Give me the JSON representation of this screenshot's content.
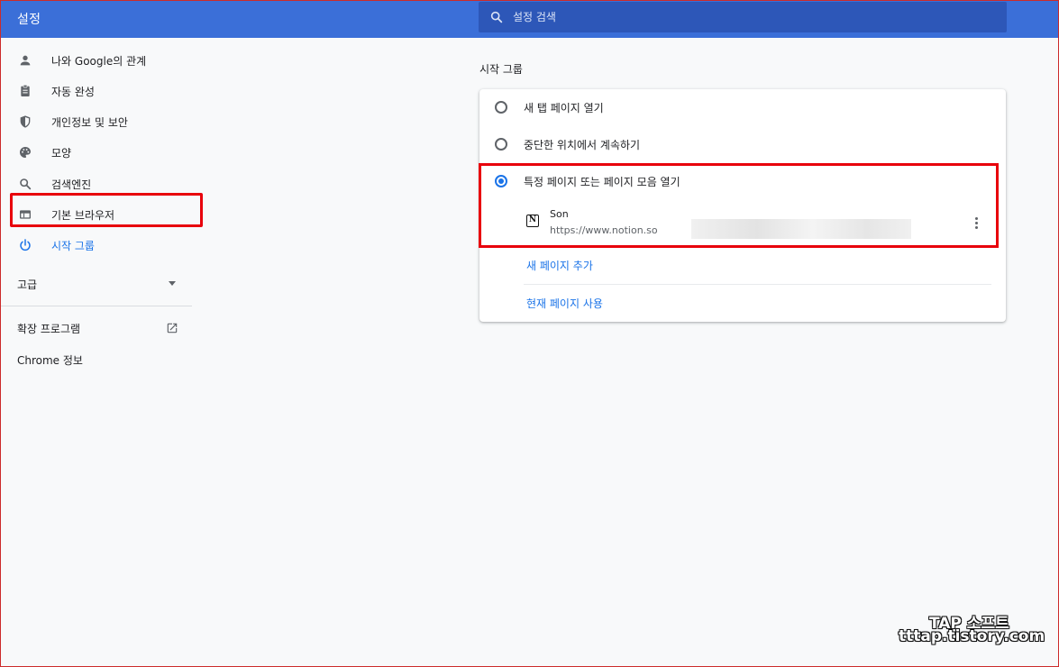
{
  "header": {
    "title": "설정",
    "search_placeholder": "설정 검색"
  },
  "sidebar": {
    "items": [
      {
        "label": "나와 Google의 관계",
        "icon": "person-icon"
      },
      {
        "label": "자동 완성",
        "icon": "clipboard-icon"
      },
      {
        "label": "개인정보 및 보안",
        "icon": "shield-icon"
      },
      {
        "label": "모양",
        "icon": "palette-icon"
      },
      {
        "label": "검색엔진",
        "icon": "search-icon"
      },
      {
        "label": "기본 브라우저",
        "icon": "browser-icon"
      },
      {
        "label": "시작 그룹",
        "icon": "power-icon",
        "active": true
      }
    ],
    "advanced_label": "고급",
    "extensions_label": "확장 프로그램",
    "about_label": "Chrome 정보"
  },
  "main": {
    "section_title": "시작 그룹",
    "options": [
      {
        "label": "새 탭 페이지 열기",
        "checked": false
      },
      {
        "label": "중단한 위치에서 계속하기",
        "checked": false
      },
      {
        "label": "특정 페이지 또는 페이지 모음 열기",
        "checked": true
      }
    ],
    "pages": [
      {
        "name": "Son",
        "url": "https://www.notion.so"
      }
    ],
    "add_page_label": "새 페이지 추가",
    "use_current_label": "현재 페이지 사용"
  },
  "watermark": {
    "line1": "TAP 소프트",
    "line2": "tttap.tistory.com"
  },
  "colors": {
    "header_bg": "#3b6fd8",
    "accent": "#1a73e8",
    "highlight": "#e8000b"
  }
}
